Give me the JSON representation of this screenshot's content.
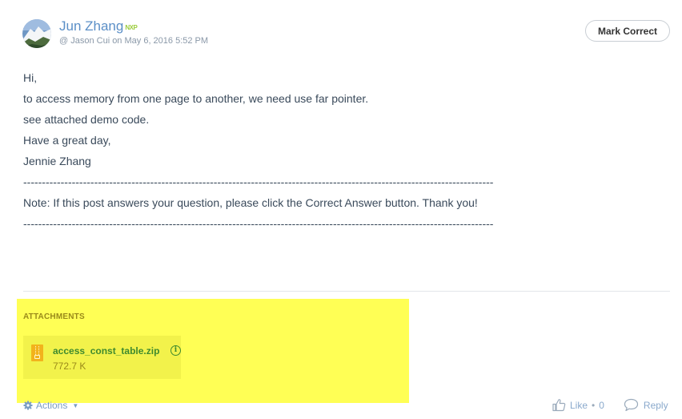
{
  "post": {
    "author_name": "Jun Zhang",
    "author_badge": "NXP",
    "subline": "@ Jason Cui on May 6, 2016 5:52 PM",
    "mark_correct_label": "Mark Correct",
    "body_lines": [
      "Hi,",
      "to access memory from one page to another, we need use far pointer.",
      "see attached demo code.",
      "",
      "Have a great day,",
      "Jennie Zhang",
      "",
      "------------------------------------------------------------------------------------------------------------------------------",
      "Note: If this post answers your question, please click the Correct Answer button. Thank you!",
      "------------------------------------------------------------------------------------------------------------------------------"
    ]
  },
  "attachments": {
    "title": "ATTACHMENTS",
    "files": [
      {
        "name": "access_const_table.zip",
        "size": "772.7 K",
        "icon": "zip-file-icon"
      }
    ]
  },
  "footer": {
    "actions_label": "Actions",
    "like_label": "Like",
    "like_separator": "•",
    "like_count": "0",
    "reply_label": "Reply"
  },
  "colors": {
    "author_link": "#5b8fc7",
    "highlight": "#ffff55",
    "attachment_link": "#3f8a2e"
  }
}
